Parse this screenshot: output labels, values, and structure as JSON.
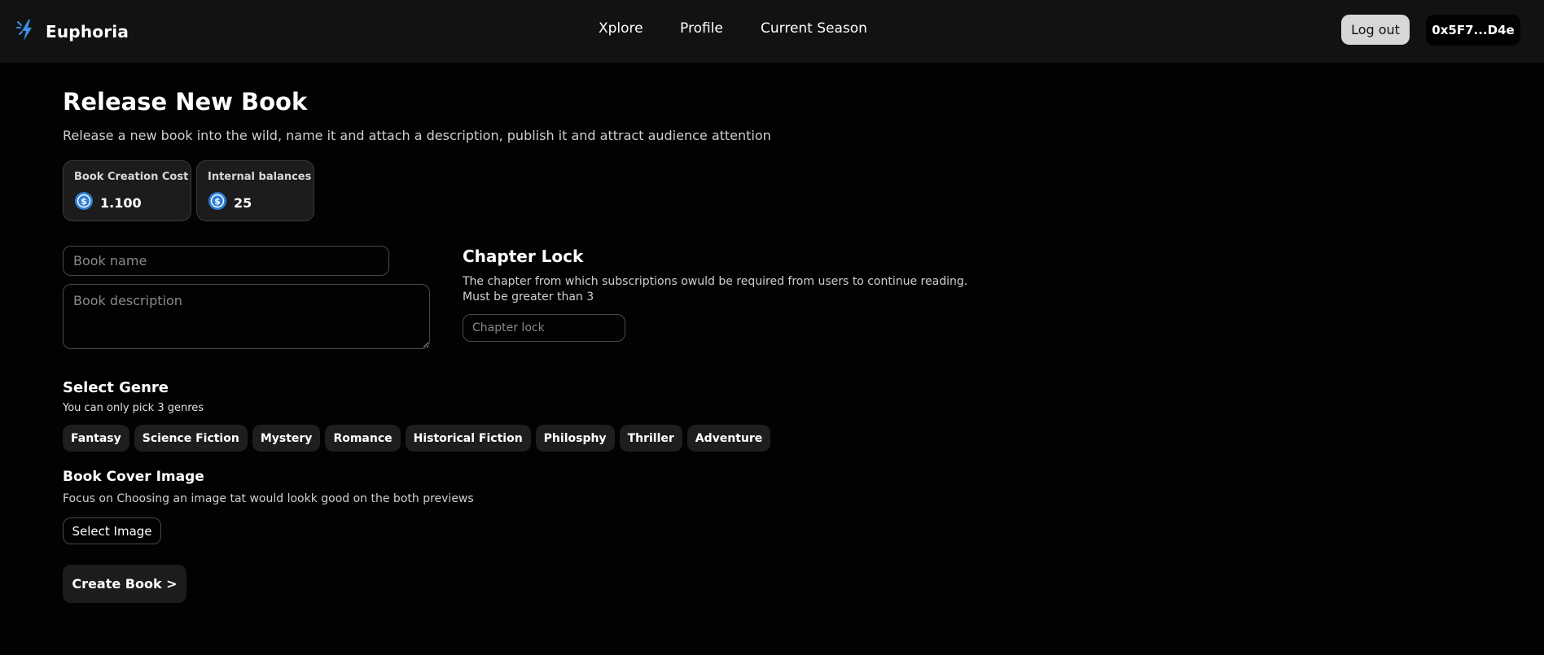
{
  "header": {
    "brand": "Euphoria",
    "nav": [
      "Xplore",
      "Profile",
      "Current Season"
    ],
    "logout_label": "Log out",
    "wallet_label": "0x5F7...D4e"
  },
  "page": {
    "title": "Release New Book",
    "subtitle": "Release a new book into the wild, name it and attach a description, publish it and attract audience attention"
  },
  "stats": {
    "creation_cost": {
      "label": "Book Creation Cost",
      "value": "1.100"
    },
    "internal_balances": {
      "label": "Internal balances",
      "value": "25"
    }
  },
  "form": {
    "book_name_placeholder": "Book name",
    "book_description_placeholder": "Book description",
    "book_name_value": "",
    "book_description_value": ""
  },
  "chapter_lock": {
    "title": "Chapter Lock",
    "description": "The chapter from which subscriptions owuld be required from users to continue reading. Must be greater than 3",
    "placeholder": "Chapter lock",
    "value": ""
  },
  "genre": {
    "title": "Select Genre",
    "subtitle": "You can only pick 3 genres",
    "options": [
      "Fantasy",
      "Science Fiction",
      "Mystery",
      "Romance",
      "Historical Fiction",
      "Philosphy",
      "Thriller",
      "Adventure"
    ]
  },
  "cover": {
    "title": "Book Cover Image",
    "subtitle": "Focus on Choosing an image tat would lookk good on the both previews",
    "select_label": "Select Image"
  },
  "create_label": "Create Book >",
  "colors": {
    "accent": "#3b8fe4",
    "background": "#020202",
    "topbar": "#121212",
    "card": "#1c1c1c"
  },
  "icons": {
    "brand": "lightning-spark-icon",
    "currency": "coin-dollar-icon"
  }
}
